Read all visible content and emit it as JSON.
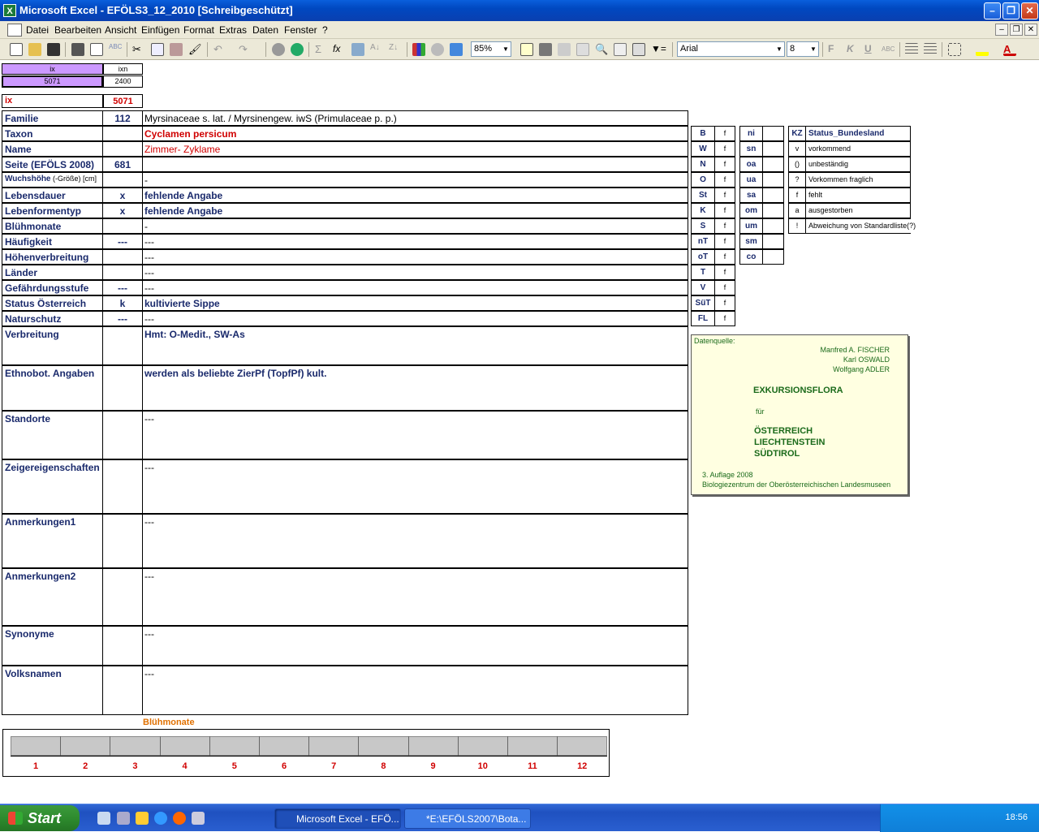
{
  "window": {
    "title": "Microsoft Excel - EFÖLS3_12_2010  [Schreibgeschützt]"
  },
  "menu": [
    "Datei",
    "Bearbeiten",
    "Ansicht",
    "Einfügen",
    "Format",
    "Extras",
    "Daten",
    "Fenster",
    "?"
  ],
  "toolbar": {
    "zoom": "85%",
    "font": "Arial",
    "size": "8",
    "bold": "F",
    "italic": "K",
    "underline": "U",
    "abc": "ABC"
  },
  "top": {
    "ix_h": "ix",
    "ixn_h": "ixn",
    "ix_v": "5071",
    "ixn_v": "2400",
    "ix_label": "ix",
    "ix_label_v": "5071"
  },
  "rows": [
    {
      "label": "Familie",
      "code": "112",
      "value": "Myrsinaceae s. lat.  /  Myrsinengew. iwS (Primulaceae p. p.)"
    },
    {
      "label": "Taxon",
      "code": "",
      "value": "Cyclamen persicum"
    },
    {
      "label": "Name",
      "code": "",
      "value": "Zimmer- Zyklame"
    },
    {
      "label": "Seite (EFÖLS 2008)",
      "code": "681",
      "value": ""
    },
    {
      "label": "Wuchshöhe",
      "label2": " (-Größe) [cm]",
      "code": "",
      "value": "  -"
    },
    {
      "label": "Lebensdauer",
      "code": "x",
      "value": "fehlende Angabe"
    },
    {
      "label": "Lebenformentyp",
      "code": "x",
      "value": "fehlende Angabe"
    },
    {
      "label": "Blühmonate",
      "code": "",
      "value": "  -"
    },
    {
      "label": "Häufigkeit",
      "code": "---",
      "value": "---"
    },
    {
      "label": "Höhenverbreitung",
      "code": "",
      "value": "---"
    },
    {
      "label": "Länder",
      "code": "",
      "value": "---"
    },
    {
      "label": "Gefährdungsstufe",
      "code": "---",
      "value": "   ---"
    },
    {
      "label": "Status Österreich",
      "code": "k",
      "value": "kultivierte Sippe"
    },
    {
      "label": "Naturschutz",
      "code": "---",
      "value": "---"
    },
    {
      "label": "Verbreitung",
      "code": "",
      "value": "Hmt: O-Medit., SW-As"
    },
    {
      "label": "Ethnobot. Angaben",
      "code": "",
      "value": "werden als beliebte ZierPf (TopfPf) kult."
    },
    {
      "label": "Standorte",
      "code": "",
      "value": "---"
    },
    {
      "label": "Zeigereigenschaften",
      "code": "",
      "value": "---"
    },
    {
      "label": "Anmerkungen1",
      "code": "",
      "value": "---"
    },
    {
      "label": "Anmerkungen2",
      "code": "",
      "value": "---"
    },
    {
      "label": "Synonyme",
      "code": "",
      "value": "---"
    },
    {
      "label": "Volksnamen",
      "code": "",
      "value": "---"
    }
  ],
  "bundes1": [
    [
      "B",
      "f"
    ],
    [
      "W",
      "f"
    ],
    [
      "N",
      "f"
    ],
    [
      "O",
      "f"
    ],
    [
      "St",
      "f"
    ],
    [
      "K",
      "f"
    ],
    [
      "S",
      "f"
    ],
    [
      "nT",
      "f"
    ],
    [
      "oT",
      "f"
    ],
    [
      "T",
      "f"
    ],
    [
      "V",
      "f"
    ],
    [
      "SüT",
      "f"
    ],
    [
      "FL",
      "f"
    ]
  ],
  "bundes2": [
    "ni",
    "sn",
    "oa",
    "ua",
    "sa",
    "om",
    "um",
    "sm",
    "co"
  ],
  "legend": {
    "kz": "KZ",
    "title": "Status_Bundesland",
    "items": [
      [
        "v",
        "vorkommend"
      ],
      [
        "()",
        "unbeständig"
      ],
      [
        "?",
        "Vorkommen fraglich"
      ],
      [
        "f",
        "fehlt"
      ],
      [
        "a",
        "ausgestorben"
      ],
      [
        "!",
        "Abweichung von Standardliste(?)"
      ]
    ]
  },
  "source": {
    "label": "Datenquelle:",
    "a1": "Manfred A. FISCHER",
    "a2": "Karl OSWALD",
    "a3": "Wolfgang ADLER",
    "t1": "EXKURSIONSFLORA",
    "fuer": "für",
    "l1": "ÖSTERREICH",
    "l2": "LIECHTENSTEIN",
    "l3": "SÜDTIROL",
    "ed": "3. Auflage 2008",
    "pub": "Biologiezentrum der Oberösterreichischen Landesmuseen"
  },
  "bluete": {
    "title": "Blühmonate",
    "months": [
      "1",
      "2",
      "3",
      "4",
      "5",
      "6",
      "7",
      "8",
      "9",
      "10",
      "11",
      "12"
    ]
  },
  "taskbar": {
    "start": "Start",
    "task1": "Microsoft Excel - EFÖ...",
    "task2": "*E:\\EFÖLS2007\\Bota...",
    "clock": "18:56"
  }
}
